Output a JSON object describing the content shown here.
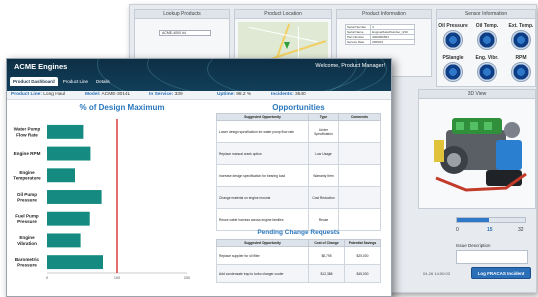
{
  "back_window": {
    "panels": {
      "lookup": "Lookup Products",
      "location": "Product Location",
      "info": "Product Information",
      "sensor": "Sensor Information"
    },
    "lookup_value": "ACME-4000 #4",
    "product_info_rows": [
      {
        "label": "Serial Number",
        "value": "4"
      },
      {
        "label": "Serial Name",
        "value": "EngineModelNumber_3/10"
      },
      {
        "label": "Part Number",
        "value": "3000000504"
      },
      {
        "label": "Service Date",
        "value": "2009/04"
      }
    ],
    "gauges_row1": [
      "Oil Pressure",
      "Oil Temp.",
      "Ext. Temp."
    ],
    "gauges_row2": [
      "PSIangle",
      "Eng. Vibr.",
      "RPM"
    ],
    "view_title": "3D View",
    "slider": {
      "min": "0",
      "value": "15",
      "max": "32",
      "fraction": 0.47
    },
    "issue_description_label": "Issue Description",
    "date_text": "04-26 14:00:03",
    "log_button": "Log FRACAS Incident"
  },
  "app": {
    "title": "ACME Engines",
    "welcome": "Welcome, Product Manager!",
    "tabs": [
      "Product Dashboard",
      "Product Line",
      "Details"
    ]
  },
  "status": {
    "product_line_label": "Product Line:",
    "product_line": "Long Haul",
    "model_label": "Model:",
    "model": "ACME-3014L",
    "in_service_label": "In Service:",
    "in_service": "339",
    "uptime_label": "Uptime:",
    "uptime": "98.2 %",
    "incidents_label": "Incidents:",
    "incidents": "3540"
  },
  "chart_data": {
    "type": "bar",
    "title": "% of Design Maximum",
    "categories": [
      "Water Pump Flow Rate",
      "Engine RPM",
      "Engine Temperature",
      "Oil Pump Pressure",
      "Fuel Pump Pressure",
      "Engine Vibration",
      "Barometric Pressure"
    ],
    "values": [
      52,
      62,
      40,
      78,
      61,
      48,
      80
    ],
    "xlim": [
      0,
      200
    ],
    "x_ticks": [
      "0",
      "100",
      "200"
    ],
    "reference_line": 100,
    "reference_color": "#d93030",
    "bar_color": "#148a80"
  },
  "opportunities": {
    "title": "Opportunities",
    "headers": [
      "Suggested Opportunity",
      "Type",
      "Comments"
    ],
    "rows": [
      {
        "opp": "Lower design specification for water pump flow rate",
        "type": "Under Specification",
        "comments": ""
      },
      {
        "opp": "Replace manual crank option",
        "type": "Low Usage",
        "comments": ""
      },
      {
        "opp": "Increase design specification for bearing load",
        "type": "Warranty Item",
        "comments": ""
      },
      {
        "opp": "Change material on engine mounts",
        "type": "Cost Reduction",
        "comments": ""
      },
      {
        "opp": "Reuse cable harness across engine families",
        "type": "Reuse",
        "comments": ""
      }
    ]
  },
  "pending": {
    "title": "Pending Change Requests",
    "headers": [
      "Suggested Opportunity",
      "Cost of Change",
      "Potential Savings"
    ],
    "rows": [
      {
        "opp": "Replace supplier for oil filter",
        "cost": "$8,795",
        "savings": "$25,000"
      },
      {
        "opp": "Add condensate trap to turbo charger cooler",
        "cost": "$12,388",
        "savings": "$45,000"
      }
    ]
  }
}
